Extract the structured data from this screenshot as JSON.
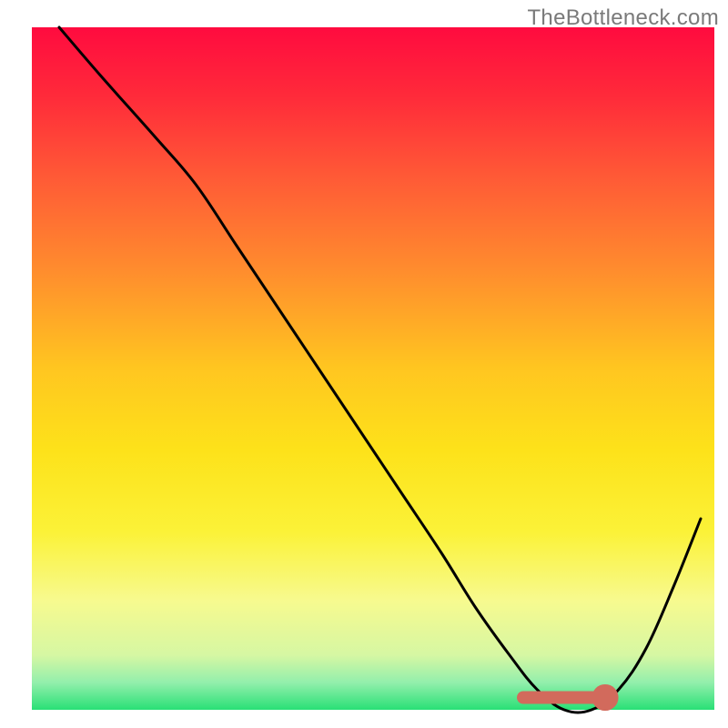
{
  "watermark": "TheBottleneck.com",
  "chart_data": {
    "type": "line",
    "title": "",
    "xlabel": "",
    "ylabel": "",
    "xlim": [
      0,
      100
    ],
    "ylim": [
      0,
      100
    ],
    "grid": false,
    "legend": false,
    "axes_visible": false,
    "background_gradient": {
      "stops": [
        {
          "offset": 0.0,
          "color": "#ff0b3f"
        },
        {
          "offset": 0.1,
          "color": "#ff2a3a"
        },
        {
          "offset": 0.22,
          "color": "#ff5a36"
        },
        {
          "offset": 0.35,
          "color": "#ff8a2e"
        },
        {
          "offset": 0.5,
          "color": "#ffc620"
        },
        {
          "offset": 0.62,
          "color": "#fde21a"
        },
        {
          "offset": 0.74,
          "color": "#fbf238"
        },
        {
          "offset": 0.84,
          "color": "#f7fa8f"
        },
        {
          "offset": 0.92,
          "color": "#d6f7a3"
        },
        {
          "offset": 0.96,
          "color": "#93efac"
        },
        {
          "offset": 1.0,
          "color": "#29e076"
        }
      ]
    },
    "series": [
      {
        "name": "bottleneck-curve",
        "color": "#000000",
        "x": [
          4,
          10,
          18,
          24,
          30,
          36,
          42,
          48,
          54,
          60,
          65,
          70,
          74,
          78,
          82,
          86,
          90,
          94,
          98
        ],
        "y": [
          100,
          93,
          84,
          77,
          68,
          59,
          50,
          41,
          32,
          23,
          15,
          8,
          3,
          0,
          0,
          3,
          9,
          18,
          28
        ]
      }
    ],
    "marker": {
      "name": "optimal-segment",
      "color": "#d26a5c",
      "x_start": 72,
      "x_end": 83,
      "y": 1.8,
      "dot_x": 84,
      "radius": 1.1
    }
  }
}
